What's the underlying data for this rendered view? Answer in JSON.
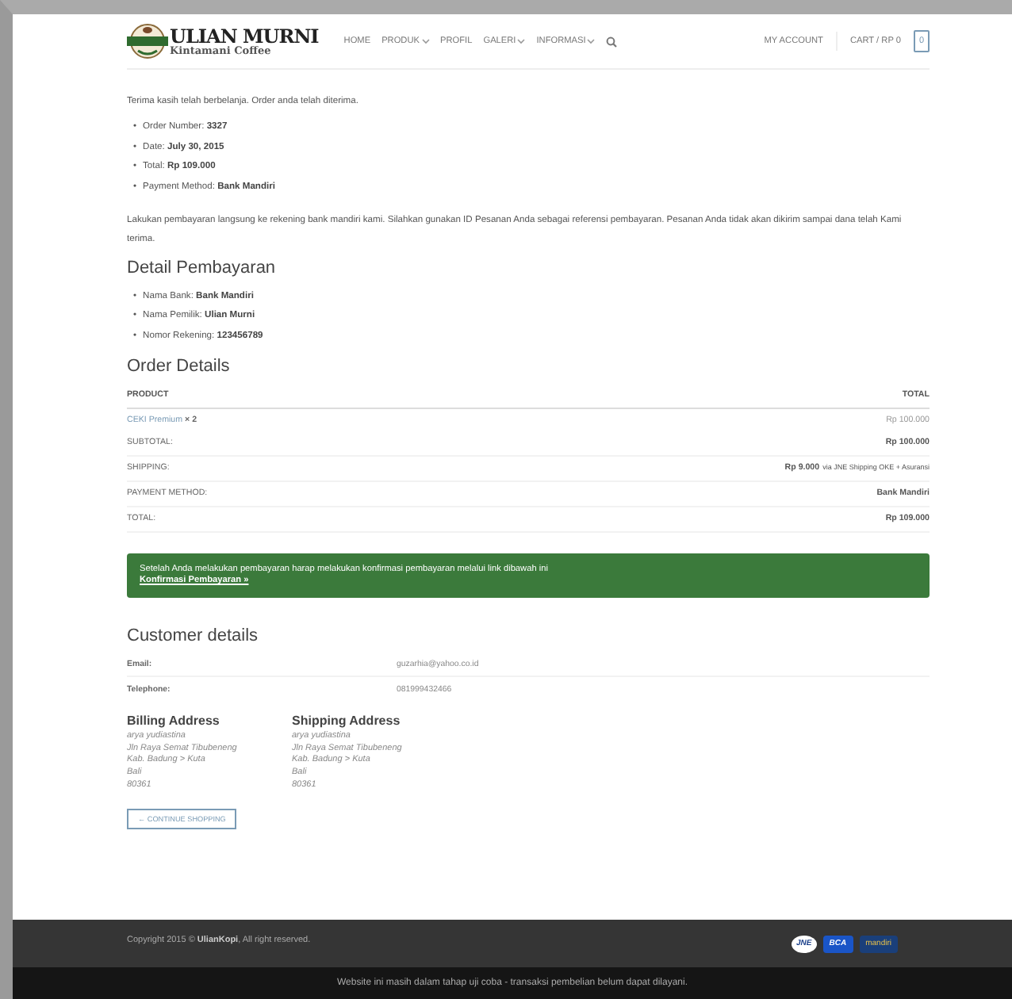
{
  "header": {
    "brand": "ULIAN MURNI",
    "tagline": "Kintamani Coffee",
    "nav": [
      {
        "label": "HOME",
        "dropdown": false
      },
      {
        "label": "PRODUK",
        "dropdown": true
      },
      {
        "label": "PROFIL",
        "dropdown": false
      },
      {
        "label": "GALERI",
        "dropdown": true
      },
      {
        "label": "INFORMASI",
        "dropdown": true
      }
    ],
    "account": "MY ACCOUNT",
    "cart": "CART / RP 0",
    "cart_count": "0"
  },
  "thanks": "Terima kasih telah berbelanja. Order anda telah diterima.",
  "bullet": "•",
  "order_summary": [
    {
      "label": "Order Number:",
      "value": "3327"
    },
    {
      "label": "Date:",
      "value": "July 30, 2015"
    },
    {
      "label": "Total:",
      "value": "Rp 109.000"
    },
    {
      "label": "Payment Method:",
      "value": "Bank Mandiri"
    }
  ],
  "instructions": "Lakukan pembayaran langsung ke rekening bank mandiri kami. Silahkan gunakan ID Pesanan Anda sebagai referensi pembayaran. Pesanan Anda tidak akan dikirim sampai dana telah Kami terima.",
  "payment_heading": "Detail Pembayaran",
  "payment_details": [
    {
      "label": "Nama Bank:",
      "value": "Bank Mandiri"
    },
    {
      "label": "Nama Pemilik:",
      "value": "Ulian Murni"
    },
    {
      "label": "Nomor Rekening:",
      "value": "123456789"
    }
  ],
  "order_heading": "Order Details",
  "table": {
    "columns": [
      "PRODUCT",
      "TOTAL"
    ],
    "item": {
      "name": "CEKI Premium",
      "qty": "× 2",
      "total": "Rp 100.000"
    },
    "rows": [
      {
        "label": "SUBTOTAL:",
        "value": "Rp 100.000"
      },
      {
        "label": "SHIPPING:",
        "value": "Rp 9.000",
        "note": "via JNE Shipping OKE + Asuransi"
      },
      {
        "label": "PAYMENT METHOD:",
        "value": "Bank Mandiri"
      },
      {
        "label": "TOTAL:",
        "value": "Rp 109.000"
      }
    ]
  },
  "notice": {
    "text": "Setelah Anda melakukan pembayaran harap melakukan konfirmasi pembayaran melalui link dibawah ini",
    "link": "Konfirmasi Pembayaran »"
  },
  "customer_heading": "Customer details",
  "customer": [
    {
      "label": "Email:",
      "value": "guzarhia@yahoo.co.id"
    },
    {
      "label": "Telephone:",
      "value": "081999432466"
    }
  ],
  "addresses": [
    {
      "title": "Billing Address",
      "lines": [
        "arya yudiastina",
        "Jln Raya Semat Tibubeneng",
        "Kab. Badung > Kuta",
        "Bali",
        "80361"
      ]
    },
    {
      "title": "Shipping Address",
      "lines": [
        "arya yudiastina",
        "Jln Raya Semat Tibubeneng",
        "Kab. Badung > Kuta",
        "Bali",
        "80361"
      ]
    }
  ],
  "continue_button": "← CONTINUE SHOPPING",
  "footer": {
    "copyright": "Copyright 2015 © **UlianKopi**, All right reserved.",
    "logos": [
      {
        "kind": "jne",
        "label": "JNE"
      },
      {
        "kind": "bca",
        "label": "BCA"
      },
      {
        "kind": "mandiri",
        "label": "mandiri"
      }
    ]
  },
  "notice_bar": "Website ini masih dalam tahap uji coba - transaksi pembelian belum dapat dilayani."
}
